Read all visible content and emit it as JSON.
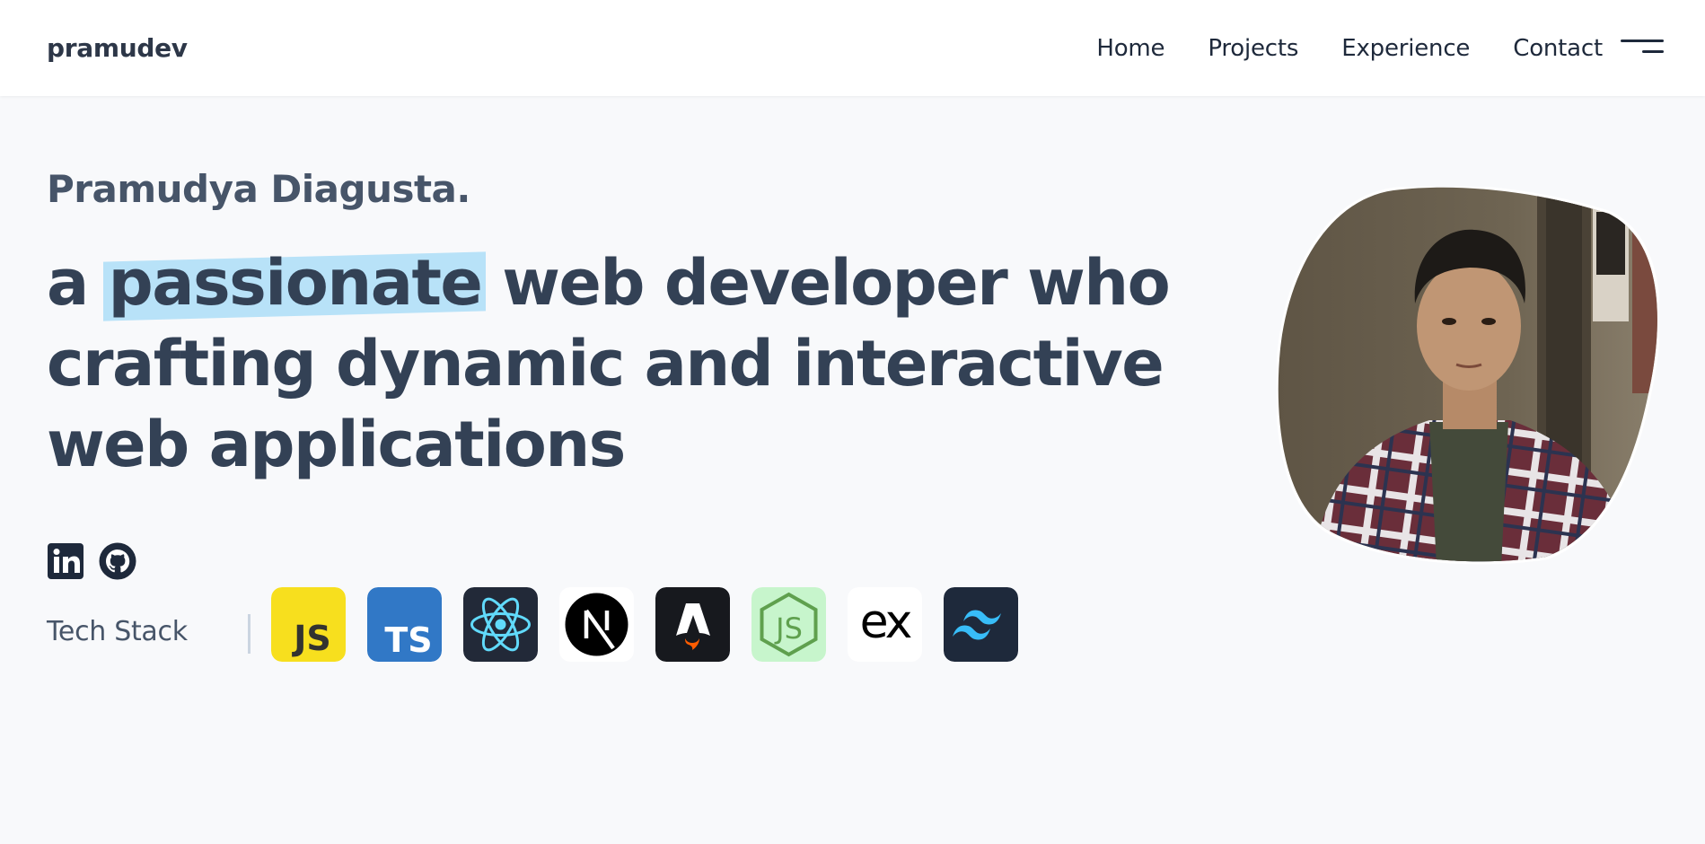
{
  "header": {
    "logo": "pramudev",
    "nav": [
      "Home",
      "Projects",
      "Experience",
      "Contact"
    ],
    "menu_icon": "hamburger-menu-icon"
  },
  "hero": {
    "name": "Pramudya Diagusta.",
    "title_line1_pre": "a ",
    "title_highlight": "passionate",
    "title_line1_post": " web developer who",
    "title_line2": "crafting dynamic and interactive",
    "title_line3": "web applications",
    "highlight_color": "#b8e2f8"
  },
  "socials": [
    {
      "icon": "linkedin-icon"
    },
    {
      "icon": "github-icon"
    }
  ],
  "tech_stack": {
    "label": "Tech Stack",
    "items": [
      {
        "icon": "javascript-icon",
        "text": "JS",
        "bg": "#f7df1e"
      },
      {
        "icon": "typescript-icon",
        "text": "TS",
        "bg": "#3178c6"
      },
      {
        "icon": "react-icon",
        "bg": "#222938"
      },
      {
        "icon": "nextjs-icon",
        "bg": "#ffffff"
      },
      {
        "icon": "astro-icon",
        "bg": "#17191e"
      },
      {
        "icon": "nodejs-icon",
        "text": "JS",
        "bg": "#c7f5cc"
      },
      {
        "icon": "express-icon",
        "text": "ex",
        "bg": "#ffffff"
      },
      {
        "icon": "tailwind-icon",
        "bg": "#1e293b"
      }
    ]
  },
  "colors": {
    "text_dark": "#334155",
    "header_bg": "#ffffff",
    "page_bg": "#f8f9fb"
  }
}
